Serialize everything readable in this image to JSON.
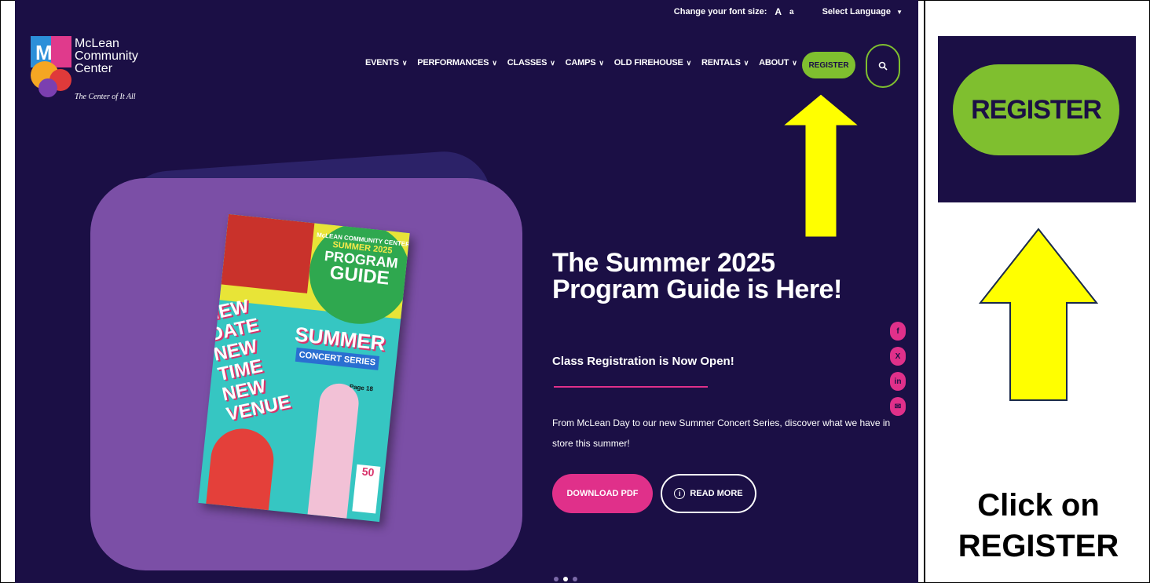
{
  "topbar": {
    "font_size_label": "Change your font size:",
    "font_large": "A",
    "font_small": "a",
    "language": "Select Language",
    "language_caret": "▼"
  },
  "logo": {
    "line1": "McLean",
    "line2": "Community",
    "line3": "Center",
    "tagline": "The Center of It All"
  },
  "nav": {
    "items": [
      {
        "label": "EVENTS"
      },
      {
        "label": "PERFORMANCES"
      },
      {
        "label": "CLASSES"
      },
      {
        "label": "CAMPS"
      },
      {
        "label": "OLD FIREHOUSE"
      },
      {
        "label": "RENTALS"
      },
      {
        "label": "ABOUT"
      }
    ],
    "chevron": "∨",
    "register": "REGISTER"
  },
  "hero": {
    "title": "The Summer 2025 Program Guide is Here!",
    "subtitle": "Class Registration is Now Open!",
    "description": "From McLean Day to our new Summer Concert Series, discover what we have in store this summer!",
    "download_button": "DOWNLOAD PDF",
    "read_more_button": "READ MORE"
  },
  "guide": {
    "org": "McLEAN COMMUNITY CENTER",
    "season": "SUMMER 2025",
    "program": "PROGRAM",
    "guide": "GUIDE",
    "new_lines": "NEW DATE NEW TIME NEW VENUE",
    "summer": "SUMMER",
    "concert": "CONCERT SERIES",
    "page": "Page 18",
    "badge": "50"
  },
  "social": [
    "f",
    "X",
    "in",
    "✉"
  ],
  "zoom": {
    "register": "REGISTER"
  },
  "instruction": {
    "line1": "Click on",
    "line2": "REGISTER"
  },
  "colors": {
    "site_bg": "#1b0f45",
    "register_green": "#7fbf2f",
    "accent_pink": "#e0308a",
    "arrow_yellow": "#ffff00",
    "card_purple": "#7b4fa6"
  }
}
